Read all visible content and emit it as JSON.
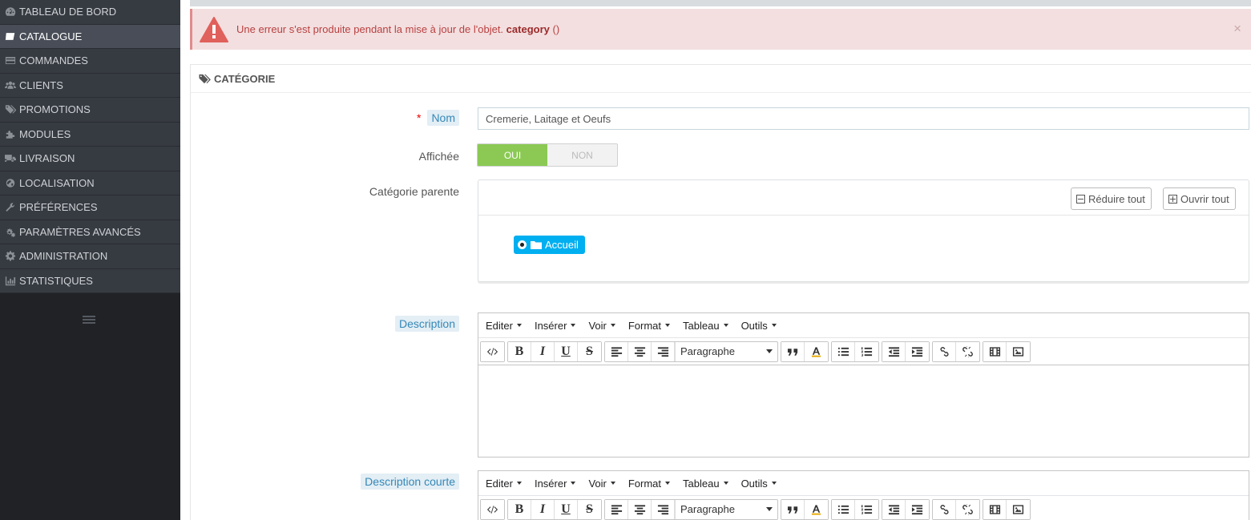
{
  "sidebar": {
    "items": [
      {
        "label": "TABLEAU DE BORD",
        "icon": "dashboard-icon",
        "active": false
      },
      {
        "label": "CATALOGUE",
        "icon": "book-icon",
        "active": true
      },
      {
        "label": "COMMANDES",
        "icon": "credit-card-icon",
        "active": false
      },
      {
        "label": "CLIENTS",
        "icon": "users-icon",
        "active": false
      },
      {
        "label": "PROMOTIONS",
        "icon": "tags-icon",
        "active": false
      },
      {
        "label": "MODULES",
        "icon": "puzzle-icon",
        "active": false
      },
      {
        "label": "LIVRAISON",
        "icon": "truck-icon",
        "active": false
      },
      {
        "label": "LOCALISATION",
        "icon": "globe-icon",
        "active": false
      },
      {
        "label": "PRÉFÉRENCES",
        "icon": "wrench-icon",
        "active": false
      },
      {
        "label": "PARAMÈTRES AVANCÉS",
        "icon": "cogs-icon",
        "active": false
      },
      {
        "label": "ADMINISTRATION",
        "icon": "cog-icon",
        "active": false
      },
      {
        "label": "STATISTIQUES",
        "icon": "bar-chart-icon",
        "active": false
      }
    ]
  },
  "alert": {
    "message": "Une erreur s'est produite pendant la mise à jour de l'objet.",
    "object": "category",
    "suffix": "()",
    "close": "×"
  },
  "panel": {
    "heading": "CATÉGORIE"
  },
  "form": {
    "name_required": "*",
    "name_label": "Nom",
    "name_value": "Cremerie, Laitage et Oeufs",
    "displayed_label": "Affichée",
    "toggle_on": "OUI",
    "toggle_off": "NON",
    "parent_label": "Catégorie parente",
    "collapse_all": "Réduire tout",
    "expand_all": "Ouvrir tout",
    "tree_root": "Accueil",
    "description_label": "Description",
    "short_description_label": "Description courte"
  },
  "editor": {
    "menus": [
      "Editer",
      "Insérer",
      "Voir",
      "Format",
      "Tableau",
      "Outils"
    ],
    "format_select": "Paragraphe"
  },
  "colors": {
    "sidebar_bg": "#363a41",
    "sidebar_active": "#484d57",
    "alert_bg": "#f3dfe0",
    "toggle_on": "#8bc954",
    "tree_node": "#00aff0"
  }
}
